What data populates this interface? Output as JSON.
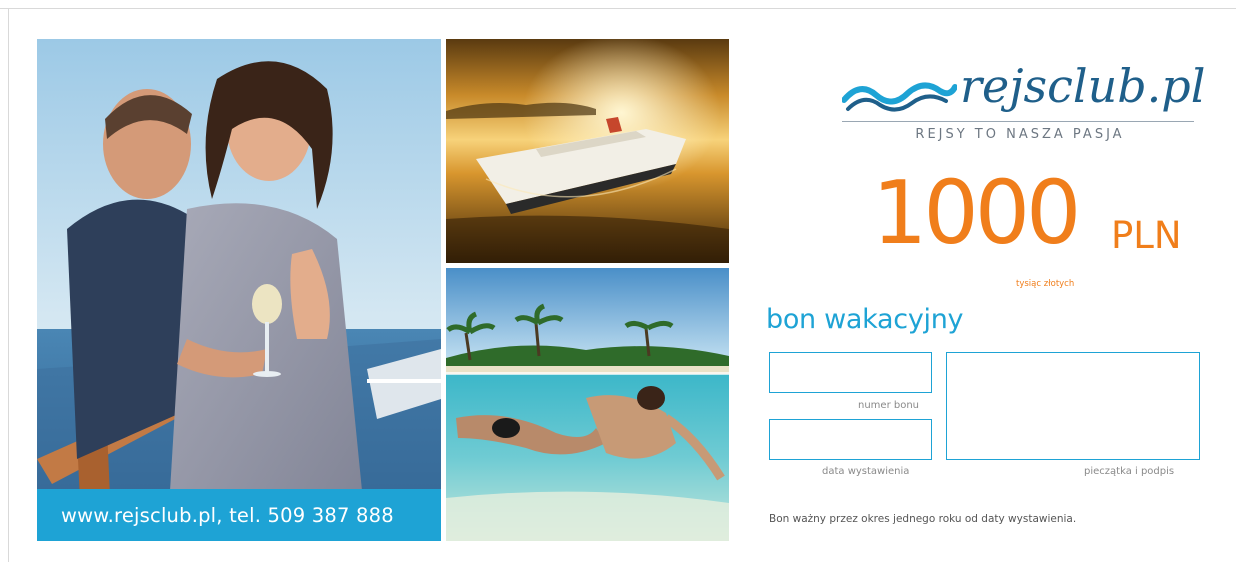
{
  "photos": {
    "couple": {
      "icon": "couple-on-cruise-deck-photo"
    },
    "ship": {
      "icon": "cruise-ship-sunset-photo"
    },
    "beach": {
      "icon": "tropical-island-underwater-photo"
    }
  },
  "contact": {
    "text": "www.rejsclub.pl, tel. 509 387 888"
  },
  "logo": {
    "brand_prefix": "rejs",
    "brand_middle": "club",
    "brand_suffix": ".pl",
    "tagline": "REJSY TO NASZA PASJA",
    "icon": "waves-logo-icon"
  },
  "voucher": {
    "amount": "1000",
    "currency": "PLN",
    "amount_words": "tysiąc złotych",
    "title": "bon wakacyjny",
    "fields": {
      "number_label": "numer bonu",
      "date_label": "data wystawienia",
      "stamp_label": "pieczątka i podpis"
    },
    "validity": "Bon ważny przez okres jednego roku od daty wystawienia."
  },
  "colors": {
    "accent_blue": "#1ea3d5",
    "accent_orange": "#f07e1b",
    "brand_navy": "#1f5f8a"
  }
}
